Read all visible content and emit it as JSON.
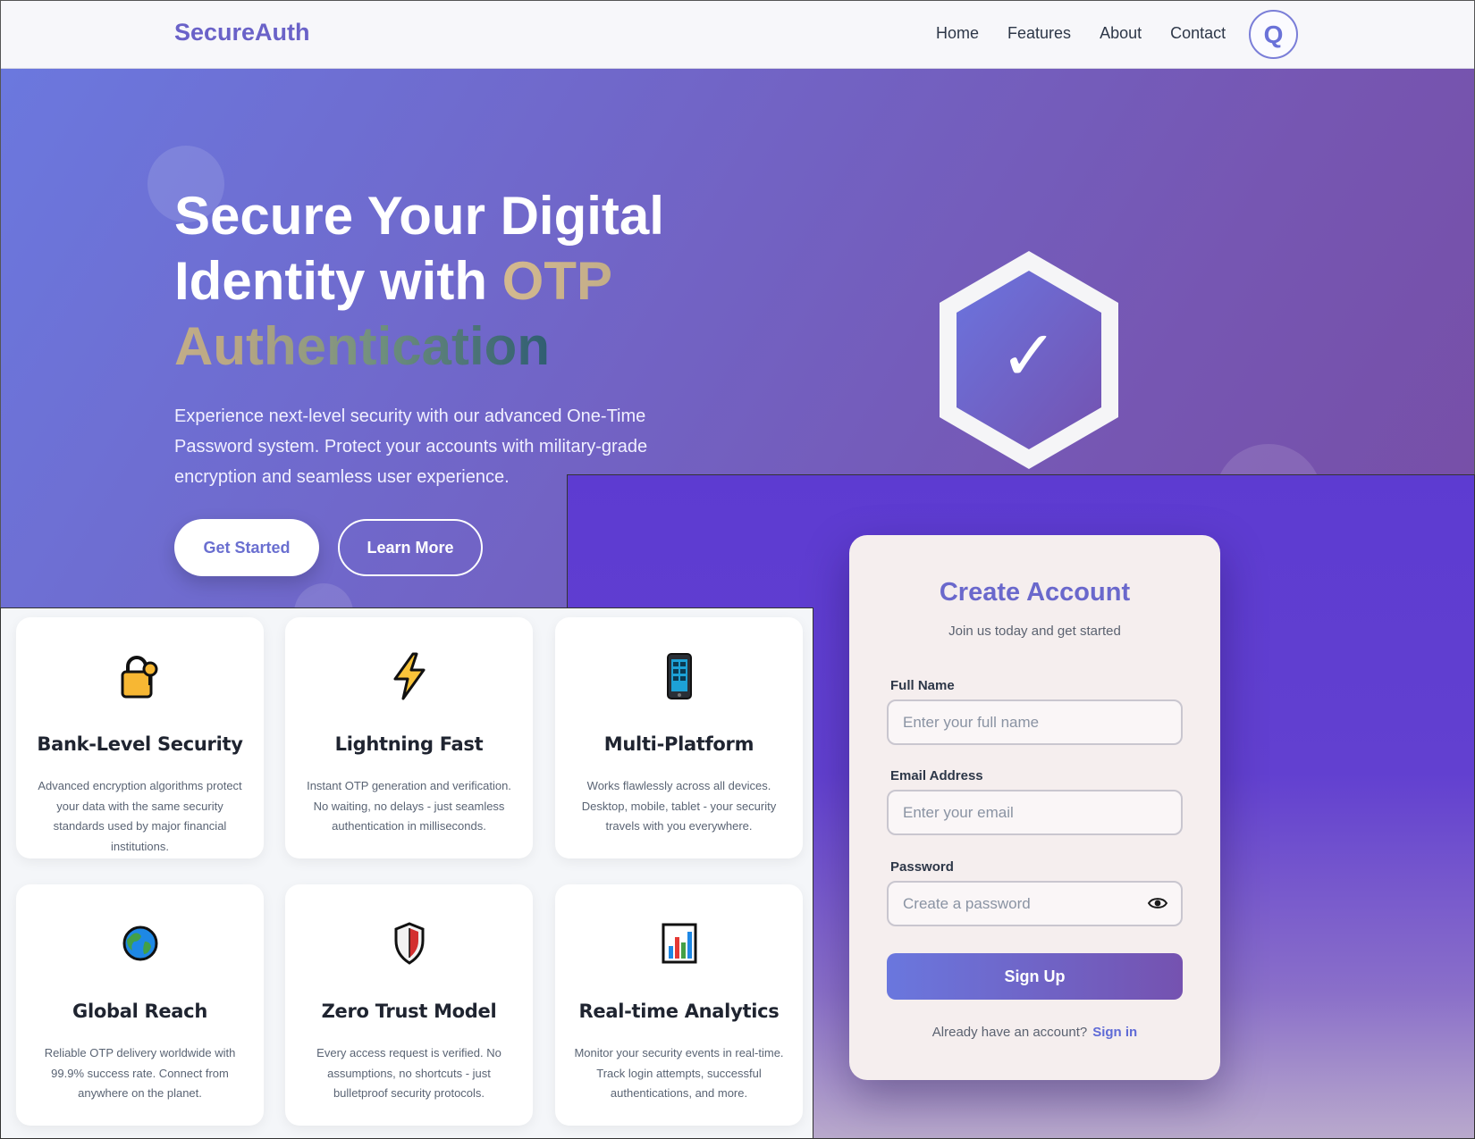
{
  "nav": {
    "brand": "SecureAuth",
    "links": [
      "Home",
      "Features",
      "About",
      "Contact"
    ],
    "avatar_letter": "Q"
  },
  "hero": {
    "title_line1": "Secure Your Digital",
    "title_line2_plain": "Identity with ",
    "title_highlight": "OTP Authentication",
    "description": "Experience next-level security with our advanced One-Time Password system. Protect your accounts with military-grade encryption and seamless user experience.",
    "btn_primary": "Get Started",
    "btn_secondary": "Learn More",
    "badge_icon": "hexagon-check-icon",
    "badge_glyph": "✓"
  },
  "features": [
    {
      "icon": "lock-key-icon",
      "title": "Bank-Level Security",
      "desc": "Advanced encryption algorithms protect your data with the same security standards used by major financial institutions."
    },
    {
      "icon": "lightning-icon",
      "title": "Lightning Fast",
      "desc": "Instant OTP generation and verification. No waiting, no delays - just seamless authentication in milliseconds."
    },
    {
      "icon": "mobile-phone-icon",
      "title": "Multi-Platform",
      "desc": "Works flawlessly across all devices. Desktop, mobile, tablet - your security travels with you everywhere."
    },
    {
      "icon": "globe-icon",
      "title": "Global Reach",
      "desc": "Reliable OTP delivery worldwide with 99.9% success rate. Connect from anywhere on the planet."
    },
    {
      "icon": "shield-icon",
      "title": "Zero Trust Model",
      "desc": "Every access request is verified. No assumptions, no shortcuts - just bulletproof security protocols."
    },
    {
      "icon": "bar-chart-icon",
      "title": "Real-time Analytics",
      "desc": "Monitor your security events in real-time. Track login attempts, successful authentications, and more."
    }
  ],
  "signup": {
    "title": "Create Account",
    "subtitle": "Join us today and get started",
    "name_label": "Full Name",
    "name_placeholder": "Enter your full name",
    "email_label": "Email Address",
    "email_placeholder": "Enter your email",
    "password_label": "Password",
    "password_placeholder": "Create a password",
    "submit": "Sign Up",
    "footer_text": "Already have an account?",
    "footer_link": "Sign in"
  },
  "colors": {
    "brand": "#6a62c8",
    "hero_start": "#6b78de",
    "hero_end": "#774ea6",
    "signup_bg": "#5d3bd1",
    "accent_link": "#5f6ad6"
  }
}
